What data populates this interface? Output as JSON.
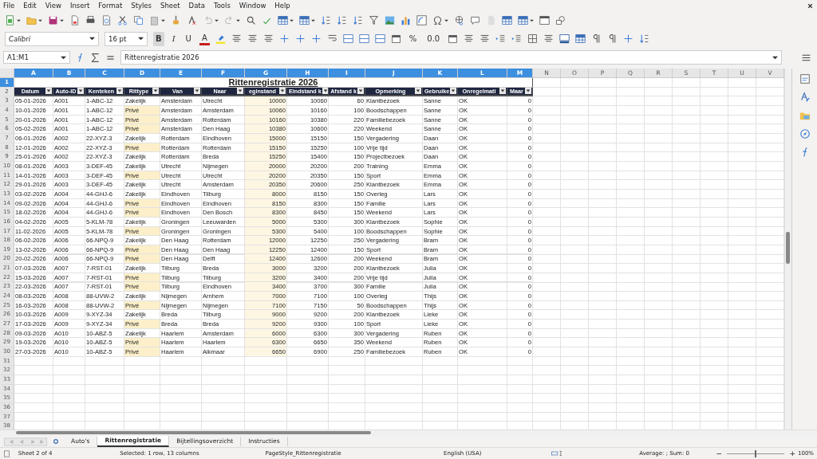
{
  "menu": [
    "File",
    "Edit",
    "View",
    "Insert",
    "Format",
    "Styles",
    "Sheet",
    "Data",
    "Tools",
    "Window",
    "Help"
  ],
  "formatting": {
    "font": "Calibri",
    "size": "16 pt",
    "bold_label": "B",
    "italic_label": "I",
    "underline_label": "U",
    "font_color_label": "A",
    "percent_label": "%",
    "decimal_label": "0.0",
    "bold": true
  },
  "formula_bar": {
    "name_box": "A1:M1",
    "content": "Rittenregistratie 2026"
  },
  "column_headers": [
    {
      "label": "A",
      "selected": true
    },
    {
      "label": "B",
      "selected": true
    },
    {
      "label": "C",
      "selected": true
    },
    {
      "label": "D",
      "selected": true
    },
    {
      "label": "E",
      "selected": true
    },
    {
      "label": "F",
      "selected": true
    },
    {
      "label": "G",
      "selected": true
    },
    {
      "label": "H",
      "selected": true
    },
    {
      "label": "I",
      "selected": true
    },
    {
      "label": "J",
      "selected": true
    },
    {
      "label": "K",
      "selected": true
    },
    {
      "label": "L",
      "selected": true
    },
    {
      "label": "M",
      "selected": true
    },
    {
      "label": "N",
      "selected": false
    },
    {
      "label": "O",
      "selected": false
    },
    {
      "label": "P",
      "selected": false
    },
    {
      "label": "Q",
      "selected": false
    },
    {
      "label": "R",
      "selected": false
    },
    {
      "label": "S",
      "selected": false
    },
    {
      "label": "T",
      "selected": false
    },
    {
      "label": "U",
      "selected": false
    },
    {
      "label": "V",
      "selected": false
    }
  ],
  "title": "Rittenregistratie 2026",
  "table_headers": [
    "Datum",
    "Auto-ID",
    "Kenteken",
    "Rittype",
    "Van",
    "Naar",
    "eginstand",
    "Eindstand k",
    "Afstand k",
    "Opmerking",
    "Gebruike",
    "Onregelmati",
    "Maar"
  ],
  "rows": [
    {
      "cells": [
        "05-01-2026",
        "A001",
        "1-ABC-12",
        "Zakelijk",
        "Amsterdam",
        "Utrecht",
        "10000",
        "10060",
        "60",
        "Klantbezoek",
        "Sanne",
        "OK",
        "0"
      ],
      "highlighted": false
    },
    {
      "cells": [
        "10-01-2026",
        "A001",
        "1-ABC-12",
        "Privé",
        "Amsterdam",
        "Amsterdam",
        "10060",
        "10160",
        "100",
        "Boodschappen",
        "Sanne",
        "OK",
        "0"
      ],
      "highlighted": true
    },
    {
      "cells": [
        "20-01-2026",
        "A001",
        "1-ABC-12",
        "Privé",
        "Amsterdam",
        "Rotterdam",
        "10160",
        "10380",
        "220",
        "Familiebezoek",
        "Sanne",
        "OK",
        "0"
      ],
      "highlighted": true
    },
    {
      "cells": [
        "05-02-2026",
        "A001",
        "1-ABC-12",
        "Privé",
        "Amsterdam",
        "Den Haag",
        "10380",
        "10600",
        "220",
        "Weekend",
        "Sanne",
        "OK",
        "0"
      ],
      "highlighted": true
    },
    {
      "cells": [
        "06-01-2026",
        "A002",
        "22-XYZ-3",
        "Zakelijk",
        "Rotterdam",
        "Eindhoven",
        "15000",
        "15150",
        "150",
        "Vergadering",
        "Daan",
        "OK",
        "0"
      ],
      "highlighted": false
    },
    {
      "cells": [
        "12-01-2026",
        "A002",
        "22-XYZ-3",
        "Privé",
        "Rotterdam",
        "Rotterdam",
        "15150",
        "15250",
        "100",
        "Vrije tijd",
        "Daan",
        "OK",
        "0"
      ],
      "highlighted": true
    },
    {
      "cells": [
        "25-01-2026",
        "A002",
        "22-XYZ-3",
        "Zakelijk",
        "Rotterdam",
        "Breda",
        "15250",
        "15400",
        "150",
        "Projectbezoek",
        "Daan",
        "OK",
        "0"
      ],
      "highlighted": false
    },
    {
      "cells": [
        "08-01-2026",
        "A003",
        "3-DEF-45",
        "Zakelijk",
        "Utrecht",
        "Nijmegen",
        "20000",
        "20200",
        "200",
        "Training",
        "Emma",
        "OK",
        "0"
      ],
      "highlighted": false
    },
    {
      "cells": [
        "14-01-2026",
        "A003",
        "3-DEF-45",
        "Privé",
        "Utrecht",
        "Utrecht",
        "20200",
        "20350",
        "150",
        "Sport",
        "Emma",
        "OK",
        "0"
      ],
      "highlighted": true
    },
    {
      "cells": [
        "29-01-2026",
        "A003",
        "3-DEF-45",
        "Zakelijk",
        "Utrecht",
        "Amsterdam",
        "20350",
        "20600",
        "250",
        "Klantbezoek",
        "Emma",
        "OK",
        "0"
      ],
      "highlighted": false
    },
    {
      "cells": [
        "03-02-2026",
        "A004",
        "44-GHJ-6",
        "Zakelijk",
        "Eindhoven",
        "Tilburg",
        "8000",
        "8150",
        "150",
        "Overleg",
        "Lars",
        "OK",
        "0"
      ],
      "highlighted": false
    },
    {
      "cells": [
        "09-02-2026",
        "A004",
        "44-GHJ-6",
        "Privé",
        "Eindhoven",
        "Eindhoven",
        "8150",
        "8300",
        "150",
        "Familie",
        "Lars",
        "OK",
        "0"
      ],
      "highlighted": true
    },
    {
      "cells": [
        "18-02-2026",
        "A004",
        "44-GHJ-6",
        "Privé",
        "Eindhoven",
        "Den Bosch",
        "8300",
        "8450",
        "150",
        "Weekend",
        "Lars",
        "OK",
        "0"
      ],
      "highlighted": true
    },
    {
      "cells": [
        "04-02-2026",
        "A005",
        "5-KLM-78",
        "Zakelijk",
        "Groningen",
        "Leeuwarden",
        "5000",
        "5300",
        "300",
        "Klantbezoek",
        "Sophie",
        "OK",
        "0"
      ],
      "highlighted": false
    },
    {
      "cells": [
        "11-02-2026",
        "A005",
        "5-KLM-78",
        "Privé",
        "Groningen",
        "Groningen",
        "5300",
        "5400",
        "100",
        "Boodschappen",
        "Sophie",
        "OK",
        "0"
      ],
      "highlighted": true
    },
    {
      "cells": [
        "06-02-2026",
        "A006",
        "66-NPQ-9",
        "Zakelijk",
        "Den Haag",
        "Rotterdam",
        "12000",
        "12250",
        "250",
        "Vergadering",
        "Bram",
        "OK",
        "0"
      ],
      "highlighted": false
    },
    {
      "cells": [
        "13-02-2026",
        "A006",
        "66-NPQ-9",
        "Privé",
        "Den Haag",
        "Den Haag",
        "12250",
        "12400",
        "150",
        "Sport",
        "Bram",
        "OK",
        "0"
      ],
      "highlighted": true
    },
    {
      "cells": [
        "20-02-2026",
        "A006",
        "66-NPQ-9",
        "Privé",
        "Den Haag",
        "Delft",
        "12400",
        "12600",
        "200",
        "Weekend",
        "Bram",
        "OK",
        "0"
      ],
      "highlighted": true
    },
    {
      "cells": [
        "07-03-2026",
        "A007",
        "7-RST-01",
        "Zakelijk",
        "Tilburg",
        "Breda",
        "3000",
        "3200",
        "200",
        "Klantbezoek",
        "Julia",
        "OK",
        "0"
      ],
      "highlighted": false
    },
    {
      "cells": [
        "15-03-2026",
        "A007",
        "7-RST-01",
        "Privé",
        "Tilburg",
        "Tilburg",
        "3200",
        "3400",
        "200",
        "Vrije tijd",
        "Julia",
        "OK",
        "0"
      ],
      "highlighted": true
    },
    {
      "cells": [
        "22-03-2026",
        "A007",
        "7-RST-01",
        "Privé",
        "Tilburg",
        "Eindhoven",
        "3400",
        "3700",
        "300",
        "Familie",
        "Julia",
        "OK",
        "0"
      ],
      "highlighted": true
    },
    {
      "cells": [
        "08-03-2026",
        "A008",
        "88-UVW-2",
        "Zakelijk",
        "Nijmegen",
        "Arnhem",
        "7000",
        "7100",
        "100",
        "Overleg",
        "Thijs",
        "OK",
        "0"
      ],
      "highlighted": false
    },
    {
      "cells": [
        "16-03-2026",
        "A008",
        "88-UVW-2",
        "Privé",
        "Nijmegen",
        "Nijmegen",
        "7100",
        "7150",
        "50",
        "Boodschappen",
        "Thijs",
        "OK",
        "0"
      ],
      "highlighted": true
    },
    {
      "cells": [
        "10-03-2026",
        "A009",
        "9-XYZ-34",
        "Zakelijk",
        "Breda",
        "Tilburg",
        "9000",
        "9200",
        "200",
        "Klantbezoek",
        "Lieke",
        "OK",
        "0"
      ],
      "highlighted": false
    },
    {
      "cells": [
        "17-03-2026",
        "A009",
        "9-XYZ-34",
        "Privé",
        "Breda",
        "Breda",
        "9200",
        "9300",
        "100",
        "Sport",
        "Lieke",
        "OK",
        "0"
      ],
      "highlighted": true
    },
    {
      "cells": [
        "09-03-2026",
        "A010",
        "10-ABZ-5",
        "Zakelijk",
        "Haarlem",
        "Amsterdam",
        "6000",
        "6300",
        "300",
        "Vergadering",
        "Ruben",
        "OK",
        "0"
      ],
      "highlighted": false
    },
    {
      "cells": [
        "19-03-2026",
        "A010",
        "10-ABZ-5",
        "Privé",
        "Haarlem",
        "Haarlem",
        "6300",
        "6650",
        "350",
        "Weekend",
        "Ruben",
        "OK",
        "0"
      ],
      "highlighted": true
    },
    {
      "cells": [
        "27-03-2026",
        "A010",
        "10-ABZ-5",
        "Privé",
        "Haarlem",
        "Alkmaar",
        "6650",
        "6900",
        "250",
        "Familiebezoek",
        "Ruben",
        "OK",
        "0"
      ],
      "highlighted": true
    }
  ],
  "row_headers": [
    {
      "label": "1",
      "selected": true
    },
    {
      "label": "2",
      "selected": false
    },
    {
      "label": "3",
      "selected": false
    },
    {
      "label": "4",
      "selected": false
    },
    {
      "label": "5",
      "selected": false
    },
    {
      "label": "6",
      "selected": false
    },
    {
      "label": "7",
      "selected": false
    },
    {
      "label": "8",
      "selected": false
    },
    {
      "label": "9",
      "selected": false
    },
    {
      "label": "10",
      "selected": false
    },
    {
      "label": "11",
      "selected": false
    },
    {
      "label": "12",
      "selected": false
    },
    {
      "label": "13",
      "selected": false
    },
    {
      "label": "14",
      "selected": false
    },
    {
      "label": "15",
      "selected": false
    },
    {
      "label": "16",
      "selected": false
    },
    {
      "label": "17",
      "selected": false
    },
    {
      "label": "18",
      "selected": false
    },
    {
      "label": "19",
      "selected": false
    },
    {
      "label": "20",
      "selected": false
    },
    {
      "label": "21",
      "selected": false
    },
    {
      "label": "22",
      "selected": false
    },
    {
      "label": "23",
      "selected": false
    },
    {
      "label": "24",
      "selected": false
    },
    {
      "label": "25",
      "selected": false
    },
    {
      "label": "26",
      "selected": false
    },
    {
      "label": "27",
      "selected": false
    },
    {
      "label": "28",
      "selected": false
    },
    {
      "label": "29",
      "selected": false
    },
    {
      "label": "30",
      "selected": false
    },
    {
      "label": "31",
      "selected": false
    },
    {
      "label": "32",
      "selected": false
    },
    {
      "label": "33",
      "selected": false
    },
    {
      "label": "34",
      "selected": false
    },
    {
      "label": "35",
      "selected": false
    },
    {
      "label": "36",
      "selected": false
    },
    {
      "label": "37",
      "selected": false
    },
    {
      "label": "38",
      "selected": false
    }
  ],
  "sheet_tabs": [
    {
      "label": "Auto's",
      "selected": false
    },
    {
      "label": "Rittenregistratie",
      "selected": true
    },
    {
      "label": "Bijtellingsoverzicht",
      "selected": false
    },
    {
      "label": "Instructies",
      "selected": false
    }
  ],
  "status_bar": {
    "sheet": "Sheet 2 of 4",
    "selection": "Selected: 1 row, 13 columns",
    "page_style": "PageStyle_Rittenregistratie",
    "language": "English (USA)",
    "summary": "Average: ; Sum: 0",
    "zoom_out_label": "−",
    "zoom_in_label": "+",
    "zoom": "100%",
    "zoom_slider": {
      "level": 0.5
    }
  }
}
